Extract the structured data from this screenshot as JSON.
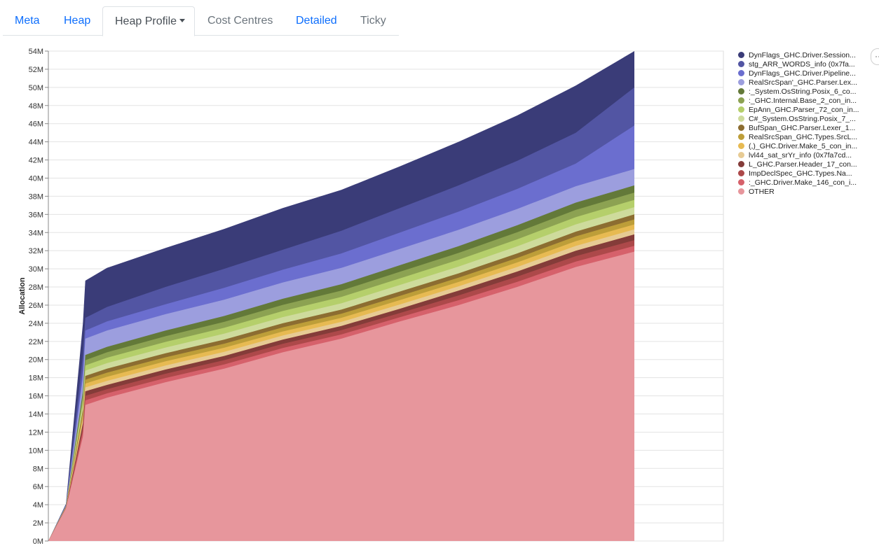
{
  "tabs": [
    {
      "label": "Meta",
      "state": "link"
    },
    {
      "label": "Heap",
      "state": "link"
    },
    {
      "label": "Heap Profile",
      "state": "active",
      "dropdown": true
    },
    {
      "label": "Cost Centres",
      "state": "disabled"
    },
    {
      "label": "Detailed",
      "state": "link"
    },
    {
      "label": "Ticky",
      "state": "disabled"
    }
  ],
  "chart_data": {
    "type": "area",
    "stacked": true,
    "ylabel": "Allocation",
    "ylim": [
      0,
      54
    ],
    "yticks": [
      "0M",
      "2M",
      "4M",
      "6M",
      "8M",
      "10M",
      "12M",
      "14M",
      "16M",
      "18M",
      "20M",
      "22M",
      "24M",
      "26M",
      "28M",
      "30M",
      "32M",
      "34M",
      "36M",
      "38M",
      "40M",
      "42M",
      "44M",
      "46M",
      "48M",
      "50M",
      "52M",
      "54M"
    ],
    "grid": true,
    "legend_position": "right",
    "stack_totals_M_order_top_to_bottom": "series listed top of stack first",
    "series": [
      {
        "name": "DynFlags_GHC.Driver.Session...",
        "color": "#3a3c78"
      },
      {
        "name": "stg_ARR_WORDS_info (0x7fa...",
        "color": "#5255a3"
      },
      {
        "name": "DynFlags_GHC.Driver.Pipeline...",
        "color": "#6b6ecf"
      },
      {
        "name": "RealSrcSpan'_GHC.Parser.Lex...",
        "color": "#9c9ede"
      },
      {
        "name": ":_System.OsString.Posix_6_co...",
        "color": "#637939"
      },
      {
        "name": ":_GHC.Internal.Base_2_con_in...",
        "color": "#8ca252"
      },
      {
        "name": "EpAnn_GHC.Parser_72_con_in...",
        "color": "#b5cf6b"
      },
      {
        "name": "C#_System.OsString.Posix_7_...",
        "color": "#cedb9c"
      },
      {
        "name": "BufSpan_GHC.Parser.Lexer_1...",
        "color": "#8c6d31"
      },
      {
        "name": "RealSrcSpan_GHC.Types.SrcL...",
        "color": "#bd9e39"
      },
      {
        "name": "(,)_GHC.Driver.Make_5_con_in...",
        "color": "#e7ba52"
      },
      {
        "name": "lvl44_sat_srYr_info (0x7fa7cd...",
        "color": "#e7cb94"
      },
      {
        "name": "L_GHC.Parser.Header_17_con...",
        "color": "#843c39"
      },
      {
        "name": "ImpDeclSpec_GHC.Types.Na...",
        "color": "#ad494a"
      },
      {
        "name": ":_GHC.Driver.Make_146_con_i...",
        "color": "#d6616b"
      },
      {
        "name": "OTHER",
        "color": "#e7969c"
      }
    ],
    "x": [
      0,
      0.03,
      0.059,
      0.063,
      0.1,
      0.2,
      0.3,
      0.4,
      0.5,
      0.6,
      0.7,
      0.8,
      0.9,
      1.0
    ],
    "x_unit": "relative time (no axis labels shown)",
    "stack_tops_M": {
      "OTHER": [
        0,
        3.6,
        11.5,
        15.0,
        15.8,
        17.5,
        19.0,
        20.8,
        22.3,
        24.2,
        26.0,
        28.0,
        30.2,
        31.9
      ],
      "group_red": [
        0,
        3.7,
        13.0,
        16.5,
        17.2,
        18.9,
        20.4,
        22.2,
        23.7,
        25.6,
        27.6,
        29.7,
        32.0,
        33.8
      ],
      "group_tan": [
        0,
        3.8,
        14.5,
        18.2,
        19.0,
        20.7,
        22.2,
        24.0,
        25.5,
        27.5,
        29.5,
        31.7,
        34.1,
        36.0
      ],
      "group_green": [
        0,
        3.85,
        16.5,
        20.5,
        21.4,
        23.2,
        24.8,
        26.7,
        28.3,
        30.4,
        32.5,
        34.8,
        37.3,
        39.2
      ],
      "RealSrcSpan'": [
        0,
        3.9,
        18.0,
        22.3,
        23.2,
        25.0,
        26.6,
        28.5,
        30.1,
        32.2,
        34.3,
        36.6,
        39.1,
        41.0
      ],
      "DynFlags_Pipeline": [
        0,
        3.95,
        18.8,
        23.2,
        24.2,
        26.1,
        27.9,
        29.9,
        31.7,
        34.0,
        36.3,
        38.8,
        41.6,
        45.8
      ],
      "stg_ARR_WORDS": [
        0,
        4.0,
        20.5,
        24.6,
        25.8,
        28.0,
        30.0,
        32.1,
        34.2,
        36.7,
        39.2,
        41.9,
        45.0,
        50.0
      ],
      "DynFlags_Session": [
        0,
        4.1,
        24.0,
        28.7,
        30.1,
        32.3,
        34.4,
        36.7,
        38.7,
        41.3,
        44.0,
        46.9,
        50.2,
        54.0
      ]
    }
  }
}
